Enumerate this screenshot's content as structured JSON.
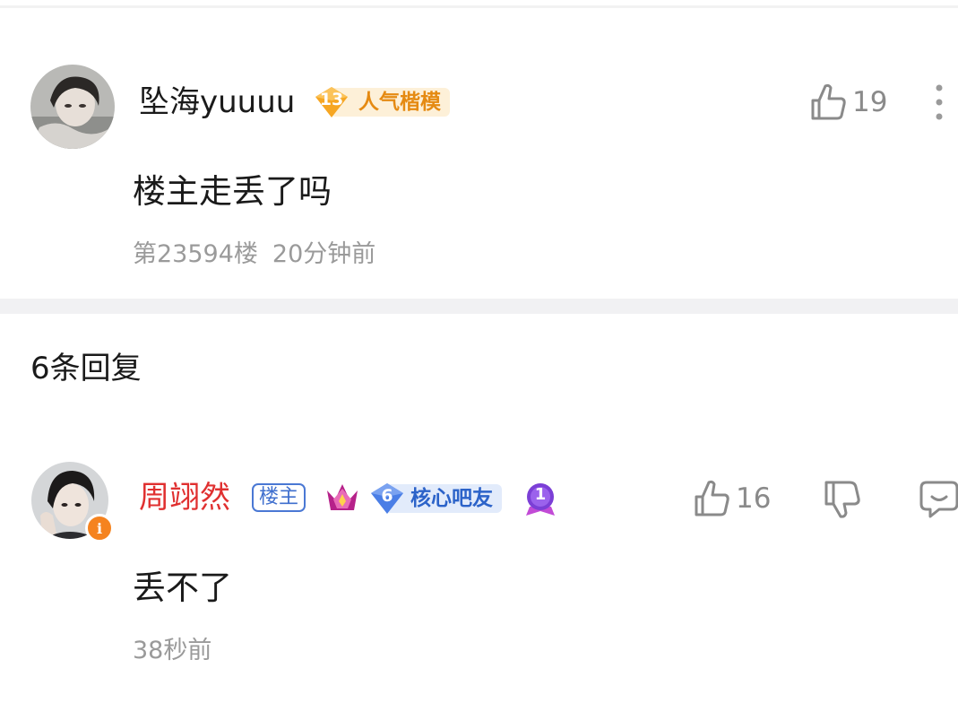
{
  "comment": {
    "username": "坠海yuuuu",
    "level_badge": {
      "level": "13",
      "title": "人气楷模"
    },
    "likes": "19",
    "content": "楼主走丢了吗",
    "floor": "第23594楼",
    "time": "20分钟前"
  },
  "replies_header": "6条回复",
  "reply": {
    "username": "周翊然",
    "owner_tag": "楼主",
    "level_badge": {
      "level": "6",
      "title": "核心吧友"
    },
    "rank_badge": "1",
    "likes": "16",
    "content": "丢不了",
    "time": "38秒前"
  },
  "icons": {
    "like": "thumbs-up-icon",
    "dislike": "thumbs-down-icon",
    "reply": "comment-bubble-icon",
    "more": "more-vertical-icon",
    "crown": "crown-badge-icon",
    "verified": "info-badge-icon"
  },
  "colors": {
    "reply_username": "#e03030",
    "orange_badge": "#f6a623",
    "blue_badge": "#4a7ee6",
    "purple_badge": "#7b3fd6",
    "meta_text": "#9a9a9a"
  }
}
